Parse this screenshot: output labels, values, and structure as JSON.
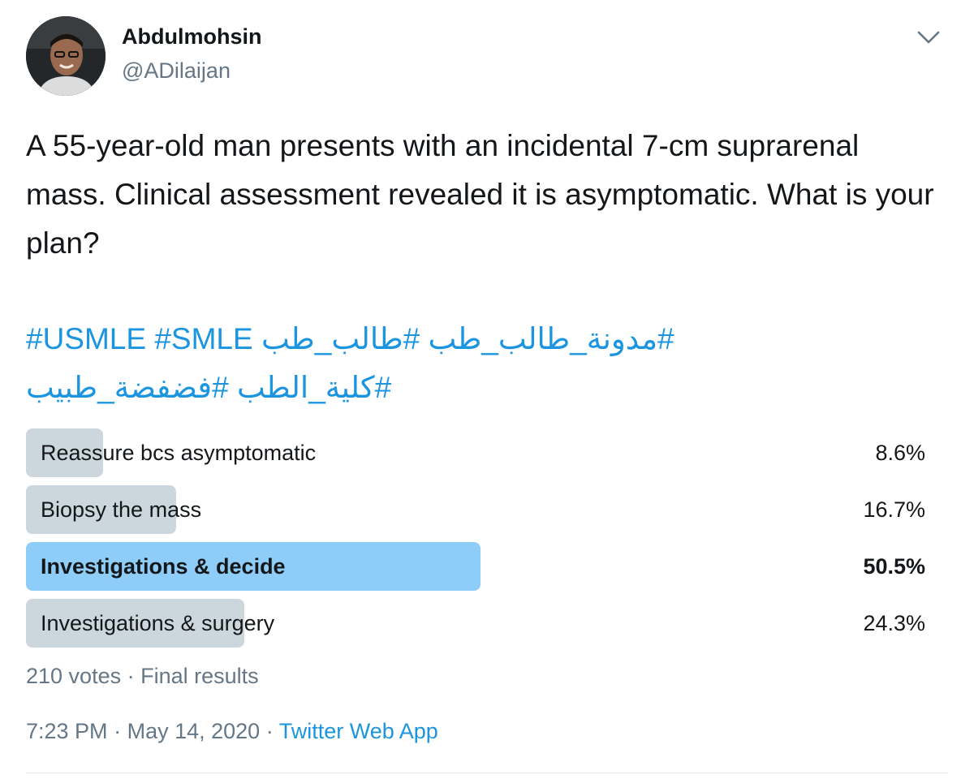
{
  "author": {
    "name": "Abdulmohsin",
    "handle": "@ADilaijan"
  },
  "tweet": {
    "text": "A 55-year-old man presents with an incidental 7-cm suprarenal mass. Clinical assessment revealed it is asymptomatic. What is your plan?",
    "hashtags_line1": [
      "#USMLE",
      "#SMLE",
      "#طالب_طب",
      "#مدونة_طالب_طب"
    ],
    "hashtags_line2": [
      "#كلية_الطب",
      "#فضفضة_طبيب"
    ]
  },
  "poll": {
    "options": [
      {
        "label": "Reassure bcs asymptomatic",
        "percent_text": "8.6%",
        "percent": 8.6,
        "winner": false
      },
      {
        "label": "Biopsy the mass",
        "percent_text": "16.7%",
        "percent": 16.7,
        "winner": false
      },
      {
        "label": "Investigations & decide",
        "percent_text": "50.5%",
        "percent": 50.5,
        "winner": true
      },
      {
        "label": "Investigations & surgery",
        "percent_text": "24.3%",
        "percent": 24.3,
        "winner": false
      }
    ],
    "votes": "210 votes",
    "status": "Final results"
  },
  "meta": {
    "time": "7:23 PM",
    "date": "May 14, 2020",
    "source": "Twitter Web App",
    "separator": "·"
  },
  "icons": {
    "menu": "chevron-down-icon",
    "avatar": "avatar"
  },
  "colors": {
    "link": "#1b95e0",
    "secondary_text": "#657786",
    "poll_bar": "#ccd6dd",
    "poll_bar_winner": "#8ecdf7"
  }
}
